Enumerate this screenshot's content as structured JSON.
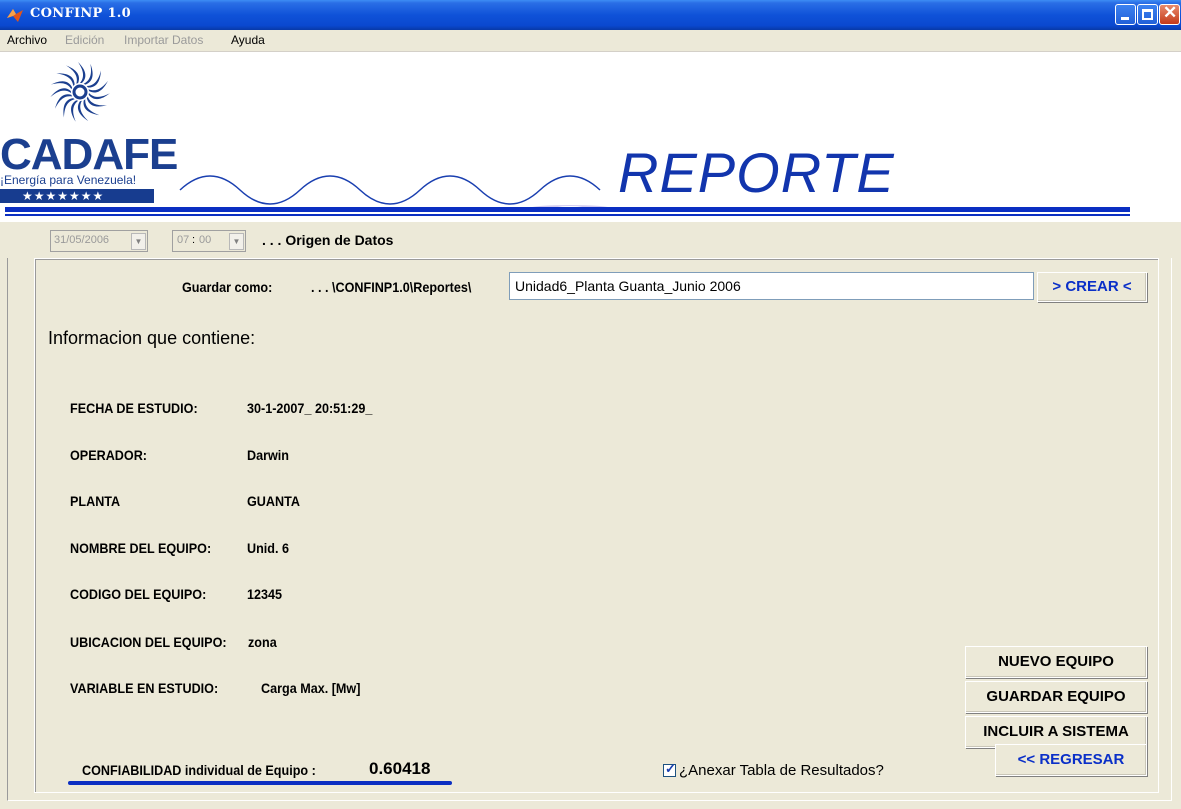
{
  "window": {
    "title": "CONFINP 1.0"
  },
  "menu": {
    "items": [
      {
        "label": "Archivo",
        "enabled": true
      },
      {
        "label": "Edición",
        "enabled": false
      },
      {
        "label": "Importar Datos",
        "enabled": false
      },
      {
        "label": "Ayuda",
        "enabled": true
      }
    ]
  },
  "header": {
    "logo_brand": "CADAFE",
    "logo_slogan": "¡Energía para Venezuela!",
    "logo_stars": "★★★★★★★",
    "title": "REPORTE"
  },
  "source": {
    "date": "31/05/2006",
    "hour": "07",
    "minute": "00",
    "label": ". . . Origen de Datos"
  },
  "save": {
    "label": "Guardar como:",
    "path": ". . . \\CONFINP1.0\\Reportes\\",
    "filename": "Unidad6_Planta Guanta_Junio 2006",
    "create_button": ">  CREAR  <"
  },
  "info": {
    "title": "Informacion que contiene:",
    "fields": [
      {
        "label": "FECHA DE ESTUDIO:",
        "value": "30-1-2007_ 20:51:29_"
      },
      {
        "label": "OPERADOR:",
        "value": "Darwin"
      },
      {
        "label": "PLANTA",
        "value": "GUANTA"
      },
      {
        "label": "NOMBRE DEL EQUIPO:",
        "value": "Unid. 6"
      },
      {
        "label": "CODIGO DEL EQUIPO:",
        "value": "12345"
      },
      {
        "label": "UBICACION DEL EQUIPO:",
        "value": "zona"
      },
      {
        "label": "VARIABLE EN ESTUDIO:",
        "value": "Carga Max. [Mw]"
      }
    ]
  },
  "buttons": {
    "new_equipment": "NUEVO EQUIPO",
    "save_equipment": "GUARDAR EQUIPO",
    "include_system": "INCLUIR A SISTEMA",
    "back": "<< REGRESAR"
  },
  "reliability": {
    "label": "CONFIABILIDAD individual de Equipo :",
    "value": "0.60418"
  },
  "annex": {
    "label": "¿Anexar Tabla de Resultados?",
    "checked": true
  }
}
